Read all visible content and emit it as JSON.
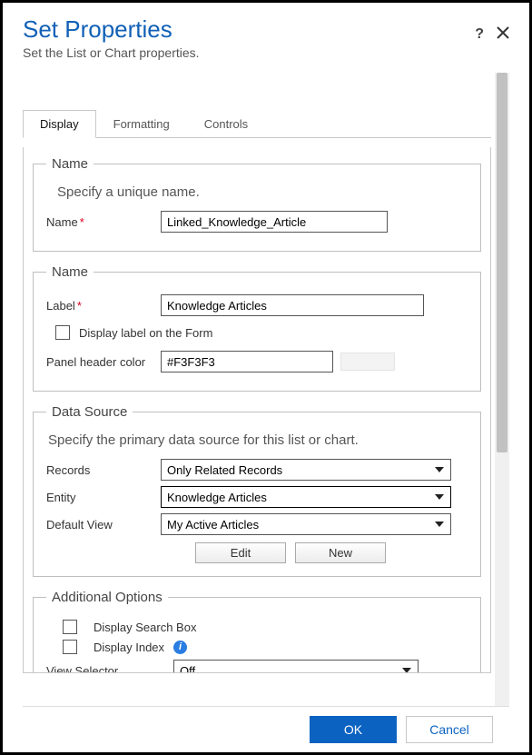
{
  "header": {
    "title": "Set Properties",
    "subtitle": "Set the List or Chart properties."
  },
  "tabs": {
    "display": "Display",
    "formatting": "Formatting",
    "controls": "Controls"
  },
  "section_name": {
    "legend": "Name",
    "intro": "Specify a unique name.",
    "name_label": "Name",
    "name_value": "Linked_Knowledge_Article"
  },
  "section_label": {
    "legend": "Name",
    "label_label": "Label",
    "label_value": "Knowledge Articles",
    "display_on_form": "Display label on the Form",
    "panel_color_label": "Panel header color",
    "panel_color_value": "#F3F3F3"
  },
  "data_source": {
    "legend": "Data Source",
    "intro": "Specify the primary data source for this list or chart.",
    "records_label": "Records",
    "records_value": "Only Related Records",
    "entity_label": "Entity",
    "entity_value": "Knowledge Articles",
    "default_view_label": "Default View",
    "default_view_value": "My Active Articles",
    "edit_btn": "Edit",
    "new_btn": "New"
  },
  "additional": {
    "legend": "Additional Options",
    "search_box": "Display Search Box",
    "display_index": "Display Index",
    "view_selector_label": "View Selector",
    "view_selector_value": "Off"
  },
  "footer": {
    "ok": "OK",
    "cancel": "Cancel"
  }
}
